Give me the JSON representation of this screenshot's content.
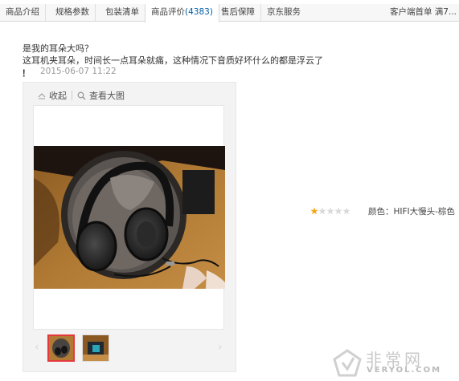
{
  "tabs": [
    {
      "label": "商品介绍"
    },
    {
      "label": "规格参数"
    },
    {
      "label": "包装清单"
    },
    {
      "label": "商品评价",
      "count": "(4383)",
      "active": true
    },
    {
      "label": "售后保障"
    },
    {
      "label": "京东服务"
    }
  ],
  "tab_right": "客户端首单 满7...",
  "review": {
    "lines": [
      "是我的耳朵大吗？",
      "这耳机夹耳朵，时间长一点耳朵就痛，这种情况下音质好坏什么的都是浮云了"
    ],
    "exclamation": "！",
    "date": "2015-06-07 11:22",
    "rating": 1,
    "rating_max": 5,
    "variant": "颜色：HIFI大慢头-棕色"
  },
  "image_panel": {
    "collapse_label": "收起",
    "view_large_label": "查看大图"
  },
  "colors": {
    "star_on": "#f7a614",
    "star_off": "#d9d9d9",
    "thumb_selected": "#e4393c",
    "link": "#005ea7"
  },
  "watermark": {
    "cn": "非常网",
    "en": "VERYOL.COM"
  }
}
